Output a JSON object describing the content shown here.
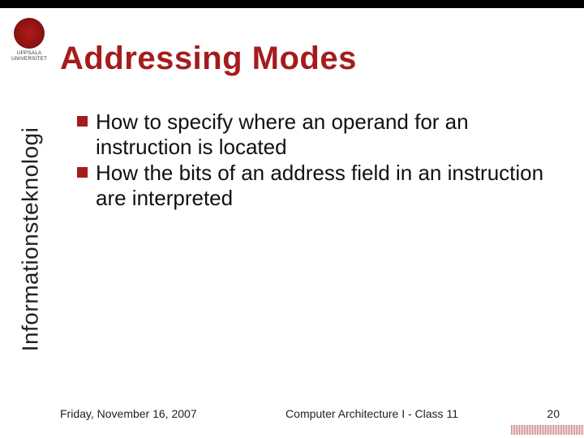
{
  "logo": {
    "name_line1": "UPPSALA",
    "name_line2": "UNIVERSITET"
  },
  "sidebar_label": "Informationsteknologi",
  "title": "Addressing Modes",
  "bullets": [
    "How to specify where an operand for an instruction is located",
    "How the bits of an address field in an instruction are interpreted"
  ],
  "footer": {
    "date": "Friday, November 16, 2007",
    "course": "Computer Architecture I - Class 11",
    "page": "20"
  }
}
